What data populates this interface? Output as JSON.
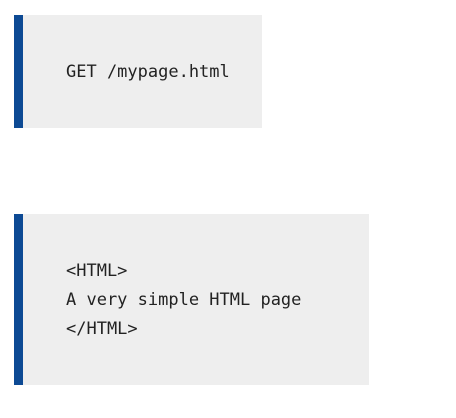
{
  "code_blocks": [
    {
      "lines": [
        "GET /mypage.html"
      ]
    },
    {
      "lines": [
        "<HTML>",
        "A very simple HTML page",
        "</HTML>"
      ]
    }
  ],
  "colors": {
    "accent_bar": "#0d4a94",
    "block_background": "#eeeeee",
    "text": "#222222"
  }
}
